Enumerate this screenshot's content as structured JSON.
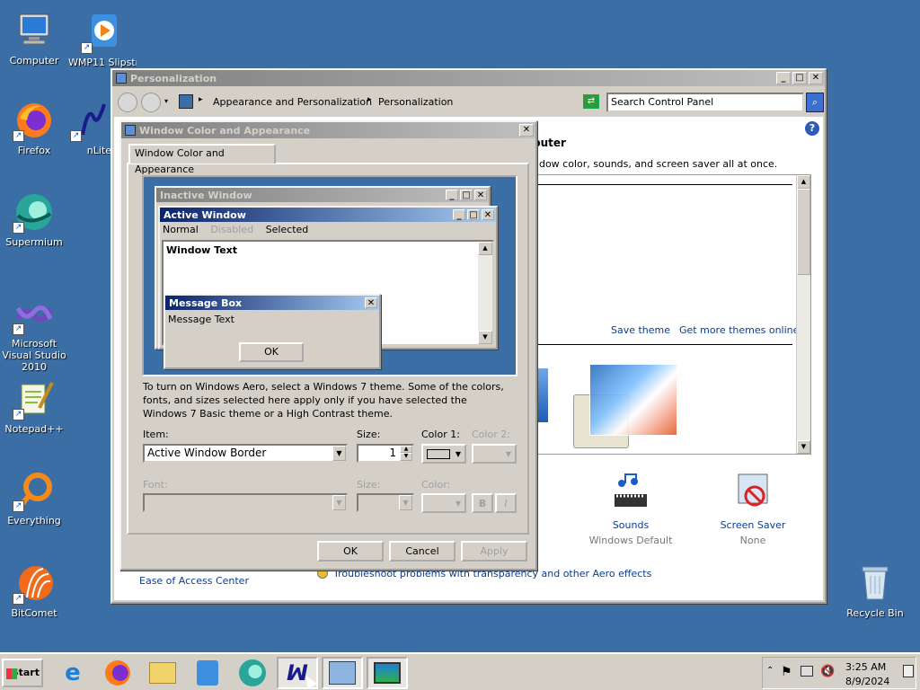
{
  "desktop": {
    "icons": [
      {
        "label": "Computer"
      },
      {
        "label": "WMP11 Slipstre..."
      },
      {
        "label": "Firefox"
      },
      {
        "label": "nLite"
      },
      {
        "label": "Supermium"
      },
      {
        "label": "Microsoft Visual Studio 2010"
      },
      {
        "label": "Notepad++"
      },
      {
        "label": "Everything"
      },
      {
        "label": "BitComet"
      },
      {
        "label": "Recycle Bin"
      }
    ]
  },
  "personalization": {
    "title": "Personalization",
    "address": {
      "part1": "Appearance and Personalization",
      "part2": "Personalization"
    },
    "search_placeholder": "Search Control Panel",
    "heading_tail": "puter",
    "description_tail": "ndow color, sounds, and screen saver all at once.",
    "save_theme": "Save theme",
    "get_more_themes": "Get more themes online",
    "sounds_label": "Sounds",
    "sounds_value": "Windows Default",
    "screensaver_label": "Screen Saver",
    "screensaver_value": "None",
    "ease_of_access": "Ease of Access Center",
    "troubleshoot": "Troubleshoot problems with transparency and other Aero effects"
  },
  "dialog": {
    "title": "Window Color and Appearance",
    "tab": "Window Color and Appearance",
    "preview": {
      "inactive_title": "Inactive Window",
      "active_title": "Active Window",
      "menu_normal": "Normal",
      "menu_disabled": "Disabled",
      "menu_selected": "Selected",
      "window_text": "Window Text",
      "msgbox_title": "Message Box",
      "msgbox_text": "Message Text",
      "msgbox_ok": "OK"
    },
    "info": "To turn on Windows Aero, select a Windows 7 theme.  Some of the colors, fonts, and sizes selected here apply only if you have selected the Windows 7 Basic theme or a High Contrast theme.",
    "item_label": "Item:",
    "item_value": "Active Window Border",
    "size_label": "Size:",
    "size_value": "1",
    "color1_label": "Color 1:",
    "color2_label": "Color 2:",
    "font_label": "Font:",
    "font_size_label": "Size:",
    "font_color_label": "Color:",
    "bold_label": "B",
    "italic_label": "I",
    "ok": "OK",
    "cancel": "Cancel",
    "apply": "Apply"
  },
  "taskbar": {
    "start": "Start",
    "time": "3:25 AM",
    "date": "8/9/2024"
  },
  "colors": {
    "desktop": "#3a6ea5",
    "active_title_start": "#0a246a",
    "active_title_end": "#a6caf0",
    "link": "#0b3d91"
  }
}
